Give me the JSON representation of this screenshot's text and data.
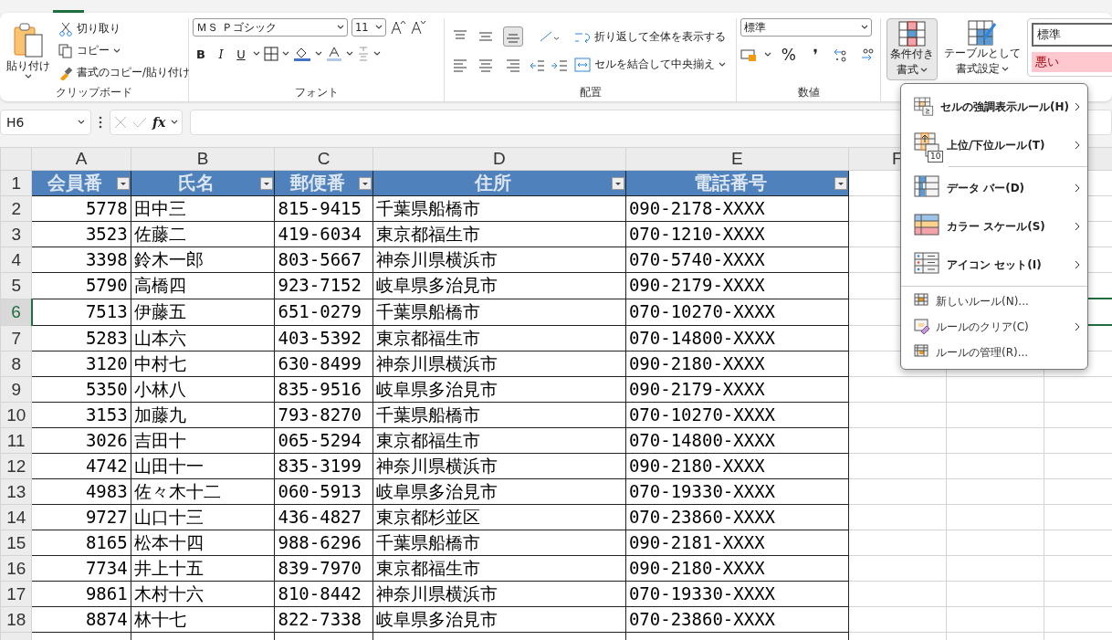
{
  "ribbon": {
    "clipboard": {
      "paste": "貼り付け",
      "cut": "切り取り",
      "copy": "コピー",
      "format_painter": "書式のコピー/貼り付け",
      "label": "クリップボード"
    },
    "font": {
      "name": "ＭＳ Ｐゴシック",
      "size": "11",
      "label": "フォント",
      "bold": "B",
      "italic": "I",
      "underline": "U"
    },
    "alignment": {
      "wrap": "折り返して全体を表示する",
      "merge": "セルを結合して中央揃え",
      "label": "配置"
    },
    "number": {
      "format": "標準",
      "percent": "%",
      "comma": "❜",
      "label": "数値"
    },
    "styles": {
      "conditional": [
        "条件付き",
        "書式"
      ],
      "table": [
        "テーブルとして",
        "書式設定"
      ],
      "gallery": [
        {
          "text": "標準",
          "kind": "normal"
        },
        {
          "text": "悪い",
          "kind": "bad"
        }
      ]
    }
  },
  "formula_bar": {
    "name_box": "H6",
    "fx": "fx"
  },
  "sheet": {
    "columns": [
      "A",
      "B",
      "C",
      "D",
      "E",
      "F"
    ],
    "header_row": "1",
    "header": [
      "会員番",
      "氏名",
      "郵便番",
      "住所",
      "電話番号"
    ],
    "rows": [
      {
        "n": "2",
        "cells": [
          "5778",
          "田中三",
          "815-9415",
          "千葉県船橋市",
          "090-2178-XXXX"
        ],
        "selected": false
      },
      {
        "n": "3",
        "cells": [
          "3523",
          "佐藤二",
          "419-6034",
          "東京都福生市",
          "070-1210-XXXX"
        ],
        "selected": false
      },
      {
        "n": "4",
        "cells": [
          "3398",
          "鈴木一郎",
          "803-5667",
          "神奈川県横浜市",
          "070-5740-XXXX"
        ],
        "selected": false
      },
      {
        "n": "5",
        "cells": [
          "5790",
          "高橋四",
          "923-7152",
          "岐阜県多治見市",
          "090-2179-XXXX"
        ],
        "selected": false
      },
      {
        "n": "6",
        "cells": [
          "7513",
          "伊藤五",
          "651-0279",
          "千葉県船橋市",
          "070-10270-XXXX"
        ],
        "selected": true
      },
      {
        "n": "7",
        "cells": [
          "5283",
          "山本六",
          "403-5392",
          "東京都福生市",
          "070-14800-XXXX"
        ],
        "selected": false
      },
      {
        "n": "8",
        "cells": [
          "3120",
          "中村七",
          "630-8499",
          "神奈川県横浜市",
          "090-2180-XXXX"
        ],
        "selected": false
      },
      {
        "n": "9",
        "cells": [
          "5350",
          "小林八",
          "835-9516",
          "岐阜県多治見市",
          "090-2179-XXXX"
        ],
        "selected": false
      },
      {
        "n": "10",
        "cells": [
          "3153",
          "加藤九",
          "793-8270",
          "千葉県船橋市",
          "070-10270-XXXX"
        ],
        "selected": false
      },
      {
        "n": "11",
        "cells": [
          "3026",
          "吉田十",
          "065-5294",
          "東京都福生市",
          "070-14800-XXXX"
        ],
        "selected": false
      },
      {
        "n": "12",
        "cells": [
          "4742",
          "山田十一",
          "835-3199",
          "神奈川県横浜市",
          "090-2180-XXXX"
        ],
        "selected": false
      },
      {
        "n": "13",
        "cells": [
          "4983",
          "佐々木十二",
          "060-5913",
          "岐阜県多治見市",
          "070-19330-XXXX"
        ],
        "selected": false
      },
      {
        "n": "14",
        "cells": [
          "9727",
          "山口十三",
          "436-4827",
          "東京都杉並区",
          "070-23860-XXXX"
        ],
        "selected": false
      },
      {
        "n": "15",
        "cells": [
          "8165",
          "松本十四",
          "988-6296",
          "千葉県船橋市",
          "090-2181-XXXX"
        ],
        "selected": false
      },
      {
        "n": "16",
        "cells": [
          "7734",
          "井上十五",
          "839-7970",
          "東京都福生市",
          "090-2180-XXXX"
        ],
        "selected": false
      },
      {
        "n": "17",
        "cells": [
          "9861",
          "木村十六",
          "810-8442",
          "神奈川県横浜市",
          "070-19330-XXXX"
        ],
        "selected": false
      },
      {
        "n": "18",
        "cells": [
          "8874",
          "林十七",
          "822-7338",
          "岐阜県多治見市",
          "070-23860-XXXX"
        ],
        "selected": false
      }
    ]
  },
  "menu": [
    {
      "kind": "large",
      "text": "セルの強調表示ルール(H)",
      "submenu": true
    },
    {
      "kind": "large",
      "text": "上位/下位ルール(T)",
      "submenu": true,
      "sub": "10"
    },
    {
      "kind": "large",
      "text": "データ バー(D)",
      "submenu": true
    },
    {
      "kind": "large",
      "text": "カラー スケール(S)",
      "submenu": true
    },
    {
      "kind": "large",
      "text": "アイコン セット(I)",
      "submenu": true
    },
    {
      "kind": "small",
      "text": "新しいルール(N)...",
      "submenu": false
    },
    {
      "kind": "small",
      "text": "ルールのクリア(C)",
      "submenu": true
    },
    {
      "kind": "small",
      "text": "ルールの管理(R)...",
      "submenu": false
    }
  ]
}
